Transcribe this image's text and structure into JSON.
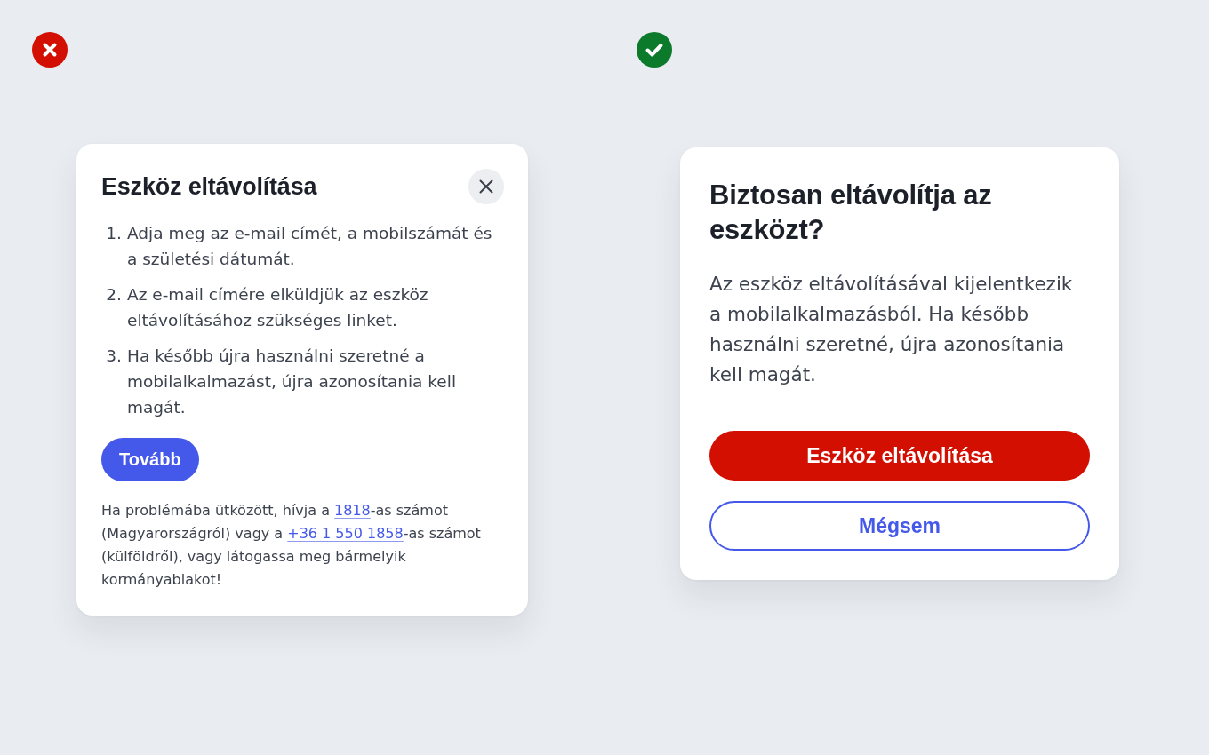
{
  "examples": [
    {
      "kind": "wrong",
      "dialog": {
        "kind": "instructions",
        "title": "Eszköz eltávolítása",
        "closable": true,
        "steps": [
          {
            "number": "1.",
            "text": "Adja meg az e-mail címét, a mobilszámát és a születési dátumát."
          },
          {
            "number": "2.",
            "text": "Az e-mail címére elküldjük az eszköz eltávolításához szükséges linket."
          },
          {
            "number": "3.",
            "text": "Ha később újra használni szeretné a mobilalkalmazást, újra azonosítania kell magát."
          }
        ],
        "buttons": [
          {
            "kind": "primary",
            "label": "Tovább"
          }
        ],
        "help_text": [
          {
            "kind": "text",
            "text": "Ha problémába ütközött, hívja a "
          },
          {
            "kind": "link",
            "text": "1818"
          },
          {
            "kind": "text",
            "text": "-as számot (Magyarországról) vagy a "
          },
          {
            "kind": "link",
            "text": "+36 1 550 1858"
          },
          {
            "kind": "text",
            "text": "-as számot (külföldről), vagy látogassa meg bármelyik kormányablakot!"
          }
        ]
      }
    },
    {
      "kind": "right",
      "dialog": {
        "kind": "confirm",
        "title": "Biztosan eltávolítja az eszközt?",
        "message": "Az eszköz eltávolításával kijelentkezik a mobilalkalmazásból. Ha később használni szeretné, újra azonosítania kell magát.",
        "buttons": [
          {
            "kind": "danger",
            "label": "Eszköz eltávolítása"
          },
          {
            "kind": "outline",
            "label": "Mégsem"
          }
        ]
      }
    }
  ]
}
